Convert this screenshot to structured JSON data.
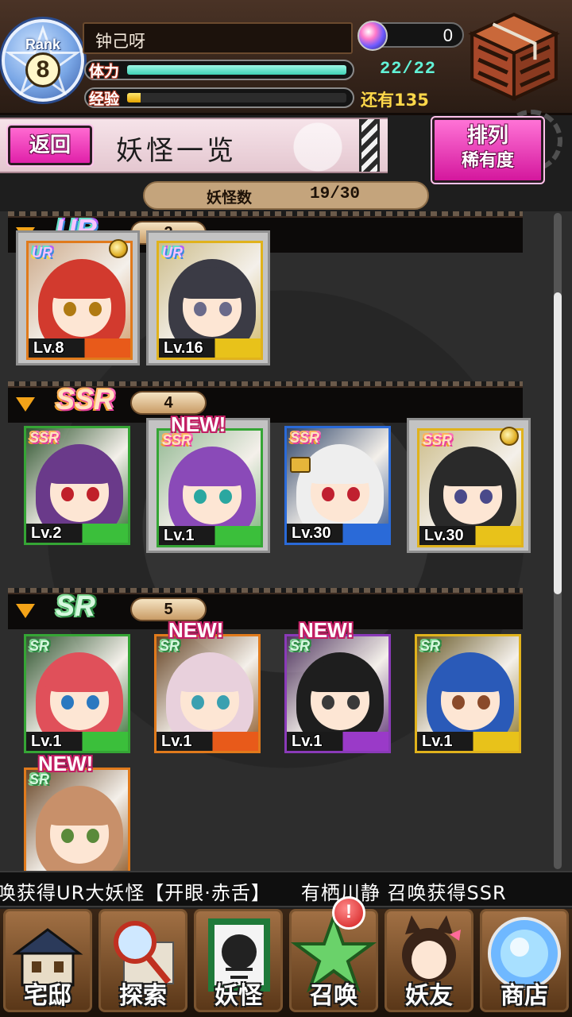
{
  "header": {
    "rank_label": "Rank",
    "rank_value": "8",
    "player_name": "钟己呀",
    "gem_count": "0",
    "stamina_label": "体力",
    "stamina_value": "22/22",
    "stamina_fill": 1.0,
    "exp_label": "经验",
    "exp_fill": 0.06,
    "exp_remaining": "还有135"
  },
  "title_bar": {
    "back_label": "返回",
    "title": "妖怪一览",
    "sort_label": "排列",
    "sort_value": "稀有度"
  },
  "count_bar": {
    "label": "妖怪数",
    "value": "19/30"
  },
  "sections": [
    {
      "rarity": "UR",
      "count": "2",
      "cards": [
        {
          "level": "Lv.8",
          "tag": "UR",
          "new": false,
          "medal": true,
          "lock": false,
          "selected": true,
          "frame": "#e07a1c",
          "bar": "#e85a1a",
          "hair": "#d23a2e",
          "eye": "#b07a12"
        },
        {
          "level": "Lv.16",
          "tag": "UR",
          "new": false,
          "medal": false,
          "lock": false,
          "selected": true,
          "frame": "#e0b21c",
          "bar": "#e8c21a",
          "hair": "#3b3b45",
          "eye": "#6a6a8a"
        }
      ]
    },
    {
      "rarity": "SSR",
      "count": "4",
      "cards": [
        {
          "level": "Lv.2",
          "tag": "SSR",
          "new": false,
          "medal": false,
          "lock": false,
          "selected": false,
          "frame": "#35a535",
          "bar": "#3bbf3b",
          "hair": "#6a3a8a",
          "eye": "#c0202a"
        },
        {
          "level": "Lv.1",
          "tag": "SSR",
          "new": true,
          "new_label": "NEW!",
          "medal": false,
          "lock": false,
          "selected": true,
          "frame": "#35a535",
          "bar": "#3bbf3b",
          "hair": "#8a4ab8",
          "eye": "#2aa7a0"
        },
        {
          "level": "Lv.30",
          "tag": "SSR",
          "new": false,
          "medal": false,
          "lock": true,
          "selected": false,
          "frame": "#2a6ad8",
          "bar": "#2a6ad8",
          "hair": "#eeeeee",
          "eye": "#c02030"
        },
        {
          "level": "Lv.30",
          "tag": "SSR",
          "new": false,
          "medal": true,
          "lock": false,
          "selected": true,
          "frame": "#e0b21c",
          "bar": "#e8c21a",
          "hair": "#2a2a2a",
          "eye": "#4a4a8a"
        }
      ]
    },
    {
      "rarity": "SR",
      "count": "5",
      "cards": [
        {
          "level": "Lv.1",
          "tag": "SR",
          "new": false,
          "medal": false,
          "lock": false,
          "selected": false,
          "frame": "#35a535",
          "bar": "#3bbf3b",
          "hair": "#e0505a",
          "eye": "#2a78c0"
        },
        {
          "level": "Lv.1",
          "tag": "SR",
          "new": true,
          "new_label": "NEW!",
          "medal": false,
          "lock": false,
          "selected": false,
          "frame": "#e07a1c",
          "bar": "#e85a1a",
          "hair": "#e8d0dc",
          "eye": "#3aa0b0"
        },
        {
          "level": "Lv.1",
          "tag": "SR",
          "new": true,
          "new_label": "NEW!",
          "medal": false,
          "lock": false,
          "selected": false,
          "frame": "#8a3ab8",
          "bar": "#9a3ac8",
          "hair": "#1e1e1e",
          "eye": "#3a3a3a"
        },
        {
          "level": "Lv.1",
          "tag": "SR",
          "new": false,
          "medal": false,
          "lock": false,
          "selected": false,
          "frame": "#e0b21c",
          "bar": "#e8c21a",
          "hair": "#2a5ab8",
          "eye": "#8a4a2a"
        },
        {
          "level": "",
          "tag": "SR",
          "new": true,
          "new_label": "NEW!",
          "medal": false,
          "lock": false,
          "selected": false,
          "frame": "#e07a1c",
          "bar": "#e85a1a",
          "hair": "#c8906a",
          "eye": "#5a8a3a"
        }
      ]
    }
  ],
  "ticker": "唤获得UR大妖怪【开眼·赤舌】　　有栖川静 召唤获得SSR",
  "nav": {
    "alert_label": "!",
    "items": [
      {
        "name": "nav-mansion",
        "label": "宅邸",
        "icon": "mansion-icon"
      },
      {
        "name": "nav-explore",
        "label": "探索",
        "icon": "magnifier-map-icon"
      },
      {
        "name": "nav-yokai",
        "label": "妖怪",
        "icon": "scroll-icon"
      },
      {
        "name": "nav-summon",
        "label": "召唤",
        "icon": "pentagram-icon"
      },
      {
        "name": "nav-friends",
        "label": "妖友",
        "icon": "catgirl-icon"
      },
      {
        "name": "nav-shop",
        "label": "商店",
        "icon": "crystal-orb-icon"
      }
    ]
  },
  "colors": {
    "accent_pink": "#e020a9",
    "stamina": "#3fd2b6",
    "exp": "#e5a400",
    "highlight_gold": "#ffd84a"
  }
}
